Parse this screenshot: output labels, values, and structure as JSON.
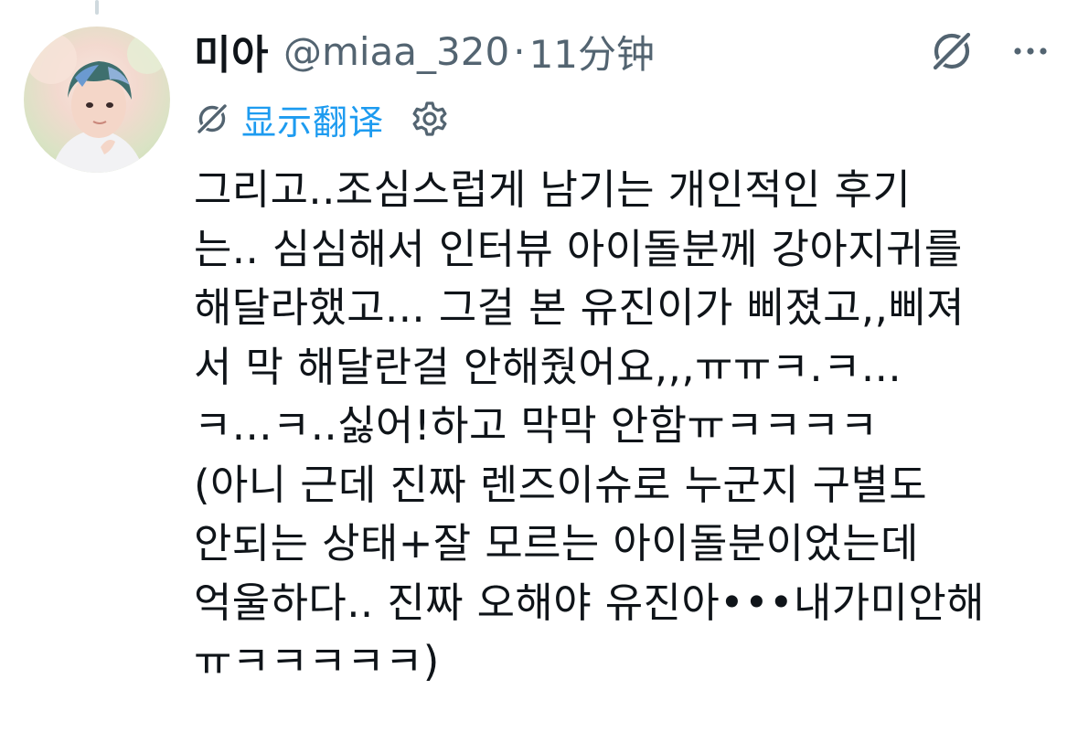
{
  "tweet": {
    "display_name": "미아",
    "handle": "@miaa_320",
    "separator": "·",
    "time": "11分钟",
    "translate_label": "显示翻译",
    "body_lines": [
      "그리고..조심스럽게 남기는 개인적인 후기",
      "는.. 심심해서 인터뷰 아이돌분께 강아지귀를",
      "해달라했고... 그걸 본 유진이가 삐졌고,,삐져",
      "서 막 해달란걸 안해줬어요,,,ㅠㅠㅋ.ㅋ...",
      "ㅋ...ㅋ..싫어!하고 막막 안함ㅠㅋㅋㅋㅋ",
      "(아니 근데 진짜 렌즈이슈로 누군지 구별도",
      "안되는 상태+잘 모르는 아이돌분이었는데",
      "억울하다.. 진짜 오해야 유진아•••내가미안해",
      "ㅠㅋㅋㅋㅋㅋ)"
    ]
  },
  "icons": {
    "grok": "grok-icon",
    "more": "more-icon",
    "translate": "translate-icon",
    "settings": "gear-icon"
  },
  "colors": {
    "text": "#0f1419",
    "secondary": "#536471",
    "link": "#1d9bf0",
    "thread_line": "#cfd9de"
  }
}
